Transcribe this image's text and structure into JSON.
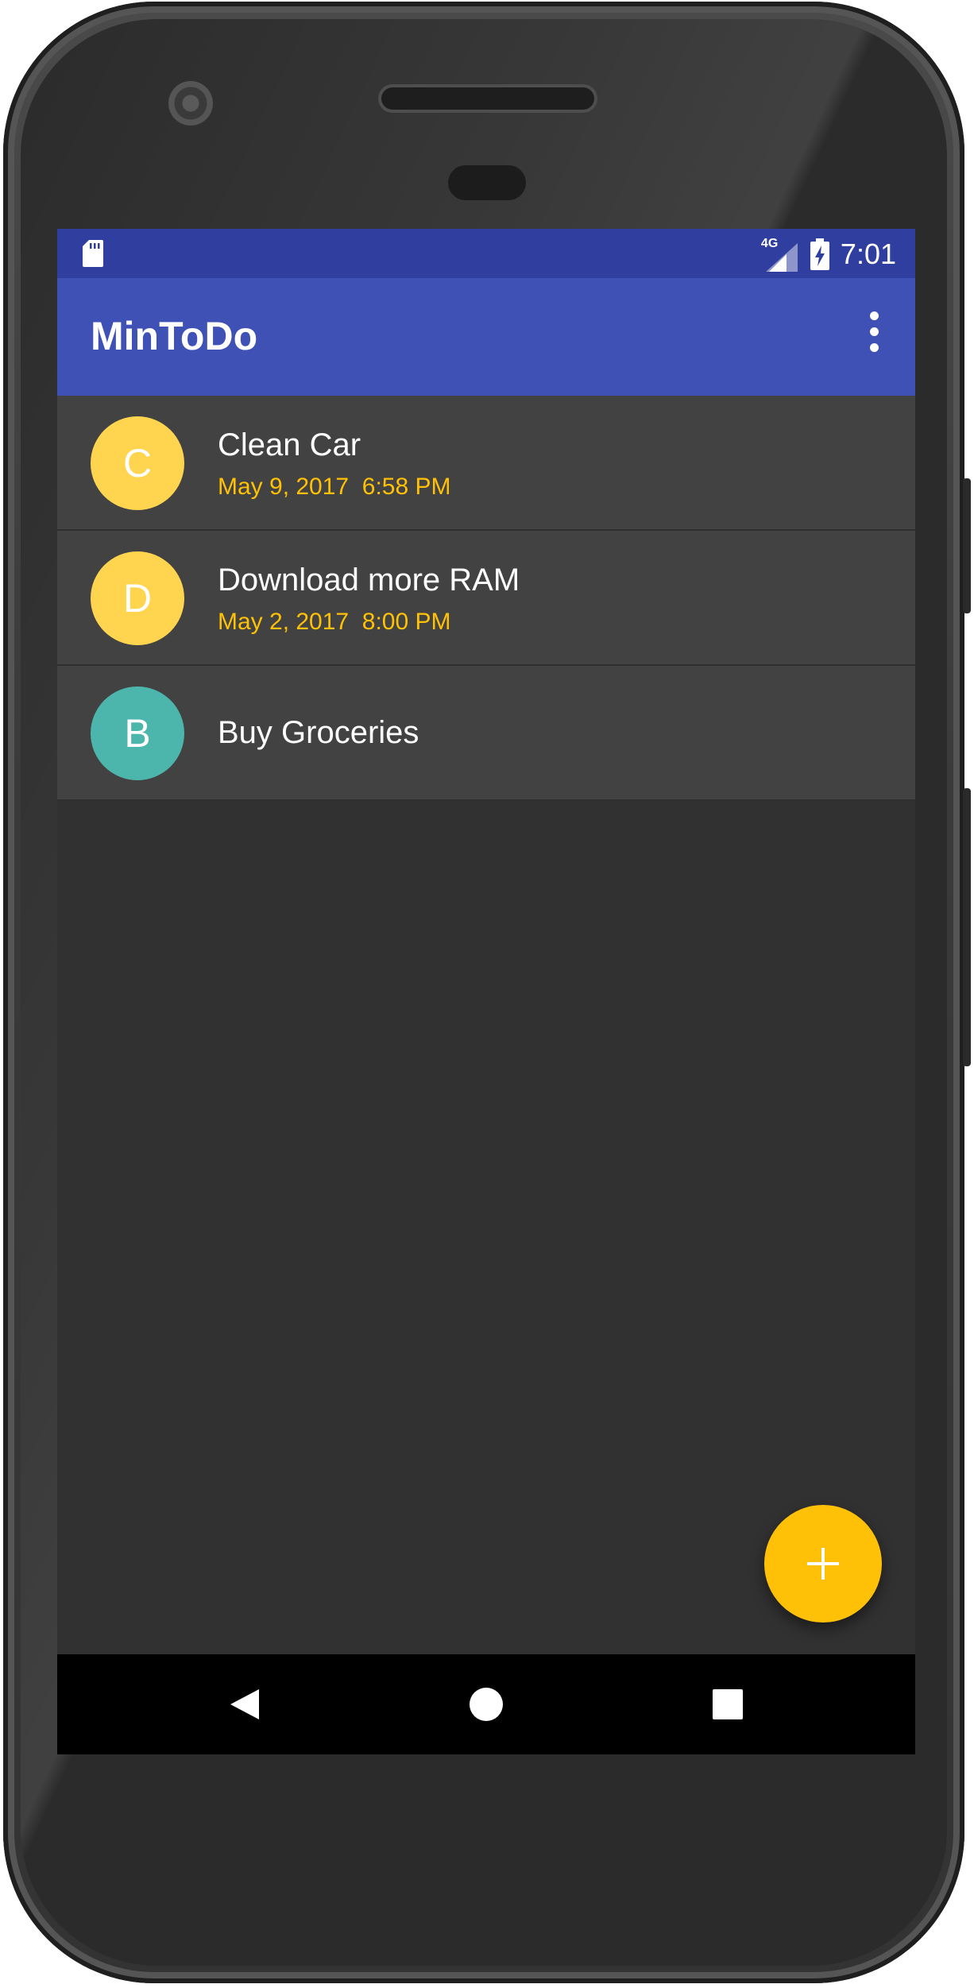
{
  "status_bar": {
    "network": "4G",
    "time": "7:01"
  },
  "app_bar": {
    "title": "MinToDo"
  },
  "todos": [
    {
      "letter": "C",
      "title": "Clean Car",
      "reminder": "May 9, 2017  6:58 PM",
      "color": "#ffd54f"
    },
    {
      "letter": "D",
      "title": "Download more RAM",
      "reminder": "May 2, 2017  8:00 PM",
      "color": "#ffd54f"
    },
    {
      "letter": "B",
      "title": "Buy Groceries",
      "reminder": "",
      "color": "#4db6ac"
    }
  ],
  "colors": {
    "status_bar": "#303f9f",
    "app_bar": "#3f51b5",
    "list_item": "#424242",
    "background": "#313131",
    "accent": "#ffc107"
  },
  "icons": {
    "status_left": "sd-card-icon",
    "signal": "signal-icon",
    "battery": "battery-charging-icon",
    "menu": "overflow-menu-icon",
    "fab": "add-icon",
    "nav_back": "back-icon",
    "nav_home": "home-icon",
    "nav_recents": "recents-icon"
  }
}
